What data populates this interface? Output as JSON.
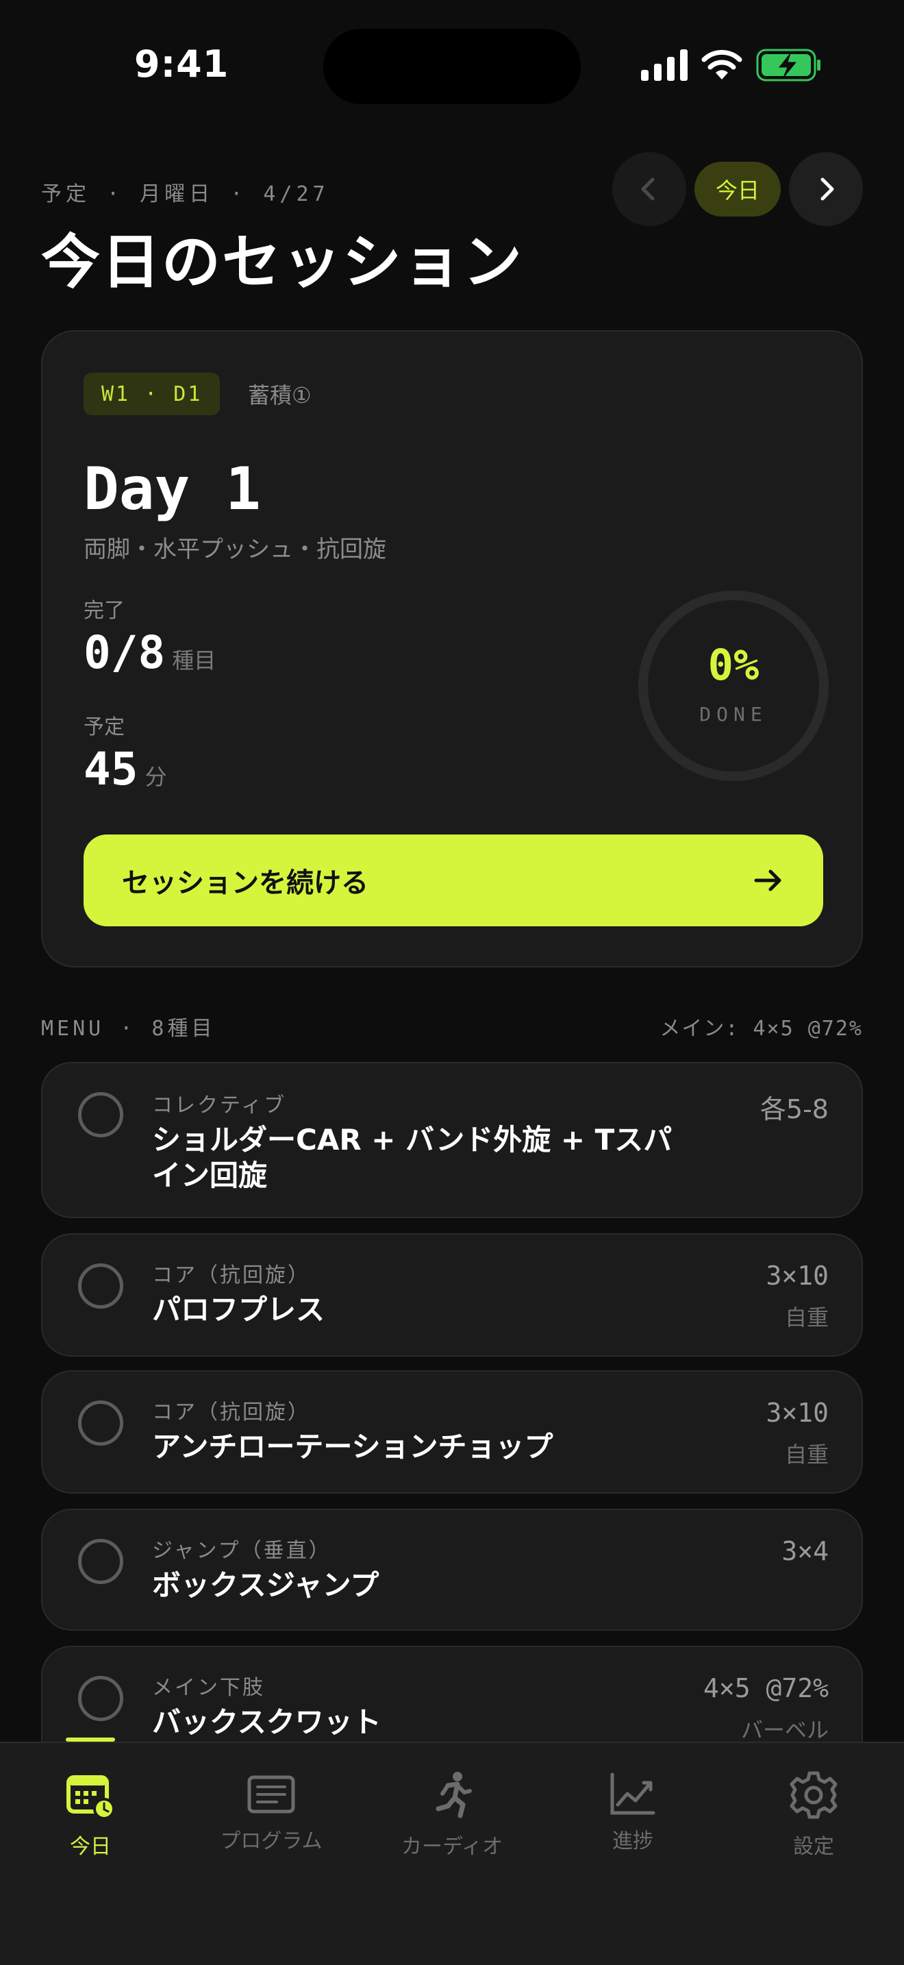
{
  "status_bar": {
    "time": "9:41"
  },
  "header": {
    "subtitle": "予定 · 月曜日 · 4/27",
    "title": "今日のセッション",
    "today_label": "今日"
  },
  "session": {
    "week_day": "W1 · D1",
    "phase": "蓄積①",
    "day_title": "Day 1",
    "focus": "両脚・水平プッシュ・抗回旋",
    "completed_label": "完了",
    "completed_value": "0/8",
    "completed_unit": "種目",
    "planned_label": "予定",
    "planned_value": "45",
    "planned_unit": "分",
    "progress_percent": "0%",
    "progress_fraction": 0,
    "progress_caption": "DONE",
    "continue_label": "セッションを続ける"
  },
  "menu": {
    "heading": "MENU · 8種目",
    "main_lift": "メイン: 4×5 @72%",
    "items": [
      {
        "category": "コレクティブ",
        "name": "ショルダーCAR + バンド外旋 + Tスパイン回旋",
        "sets": "各5-8",
        "load": ""
      },
      {
        "category": "コア（抗回旋）",
        "name": "パロフプレス",
        "sets": "3×10",
        "load": "自重"
      },
      {
        "category": "コア（抗回旋）",
        "name": "アンチローテーションチョップ",
        "sets": "3×10",
        "load": "自重"
      },
      {
        "category": "ジャンプ（垂直）",
        "name": "ボックスジャンプ",
        "sets": "3×4",
        "load": ""
      },
      {
        "category": "メイン下肢",
        "name": "バックスクワット",
        "sets": "4×5 @72%",
        "load": "バーベル"
      }
    ]
  },
  "tabs": [
    {
      "label": "今日",
      "icon": "calendar-today-icon",
      "active": true
    },
    {
      "label": "プログラム",
      "icon": "program-list-icon",
      "active": false
    },
    {
      "label": "カーディオ",
      "icon": "running-icon",
      "active": false
    },
    {
      "label": "進捗",
      "icon": "progress-chart-icon",
      "active": false
    },
    {
      "label": "設定",
      "icon": "gear-icon",
      "active": false
    }
  ],
  "colors": {
    "accent": "#d4f53c",
    "background": "#0d0d0d",
    "card": "#1b1b1c",
    "battery": "#35c759"
  }
}
